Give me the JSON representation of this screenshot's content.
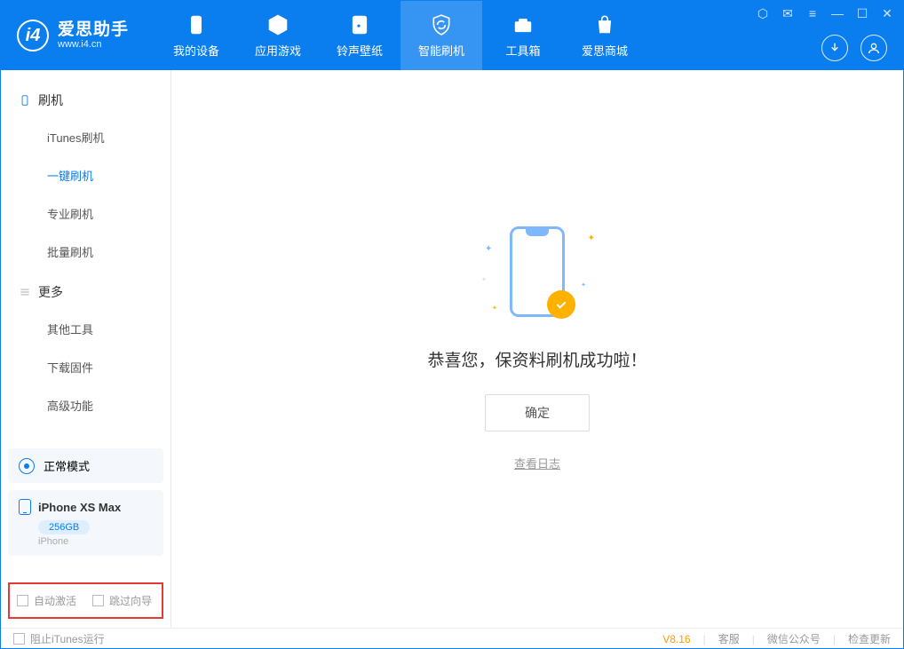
{
  "app": {
    "title": "爱思助手",
    "subtitle": "www.i4.cn"
  },
  "nav": {
    "tabs": [
      {
        "label": "我的设备"
      },
      {
        "label": "应用游戏"
      },
      {
        "label": "铃声壁纸"
      },
      {
        "label": "智能刷机"
      },
      {
        "label": "工具箱"
      },
      {
        "label": "爱思商城"
      }
    ]
  },
  "sidebar": {
    "group1": "刷机",
    "items1": [
      "iTunes刷机",
      "一键刷机",
      "专业刷机",
      "批量刷机"
    ],
    "group2": "更多",
    "items2": [
      "其他工具",
      "下载固件",
      "高级功能"
    ]
  },
  "device": {
    "mode": "正常模式",
    "name": "iPhone XS Max",
    "storage": "256GB",
    "type": "iPhone"
  },
  "options": {
    "auto_activate": "自动激活",
    "skip_guide": "跳过向导"
  },
  "main": {
    "success": "恭喜您，保资料刷机成功啦！",
    "ok": "确定",
    "view_log": "查看日志"
  },
  "footer": {
    "block_itunes": "阻止iTunes运行",
    "version": "V8.16",
    "support": "客服",
    "wechat": "微信公众号",
    "update": "检查更新"
  }
}
